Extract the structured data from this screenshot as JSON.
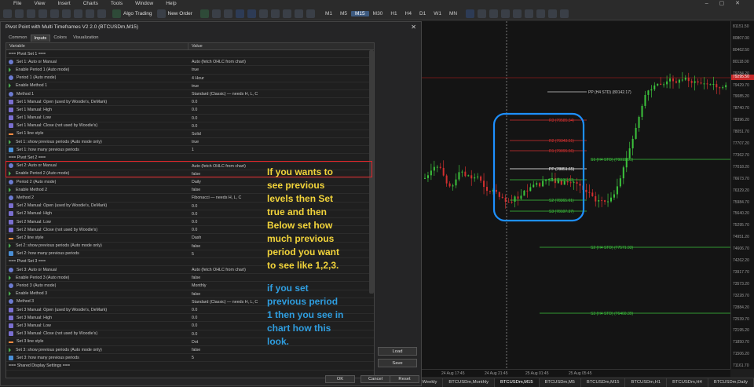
{
  "menu": [
    "File",
    "View",
    "Insert",
    "Charts",
    "Tools",
    "Window",
    "Help"
  ],
  "toolbar": {
    "algo_trading": "Algo Trading",
    "new_order": "New Order",
    "timeframes": [
      "M1",
      "M5",
      "M15",
      "M30",
      "H1",
      "H4",
      "D1",
      "W1",
      "MN"
    ],
    "active_timeframe": "M15"
  },
  "dialog": {
    "title": "Pivot Point with Multi Timeframes V2 2.0 (BTCUSDm,M15)",
    "tabs": [
      "Common",
      "Inputs",
      "Colors",
      "Visualization"
    ],
    "active_tab": "Inputs",
    "col_variable": "Variable",
    "col_value": "Value",
    "rows": [
      {
        "type": "section",
        "name": "=== Pivot Set 1 ===",
        "value": ""
      },
      {
        "icon": "circ",
        "name": "Set 1: Auto or Manual",
        "value": "Auto (fetch OHLC from chart)"
      },
      {
        "icon": "arrow",
        "name": "Enable Period 1 (Auto mode)",
        "value": "true"
      },
      {
        "icon": "circ",
        "name": "Period 1 (Auto mode)",
        "value": "4 Hour"
      },
      {
        "icon": "arrow",
        "name": "Enable Method 1",
        "value": "true"
      },
      {
        "icon": "circ",
        "name": "Method 1",
        "value": "Standard (Classic) — needs H, L, C"
      },
      {
        "icon": "num",
        "name": "Set 1 Manual: Open  (used by Woodie's, DeMark)",
        "value": "0.0"
      },
      {
        "icon": "num",
        "name": "Set 1 Manual: High",
        "value": "0.0"
      },
      {
        "icon": "num",
        "name": "Set 1 Manual: Low",
        "value": "0.0"
      },
      {
        "icon": "num",
        "name": "Set 1 Manual: Close (not used by Woodie's)",
        "value": "0.0"
      },
      {
        "icon": "line",
        "name": "Set 1 line style",
        "value": "Solid"
      },
      {
        "icon": "arrow",
        "name": "Set 1: show previous periods (Auto mode only)",
        "value": "true"
      },
      {
        "icon": "hash",
        "name": "Set 1: how many previous periods",
        "value": "1"
      },
      {
        "type": "section",
        "name": "=== Pivot Set 2 ===",
        "value": ""
      },
      {
        "icon": "circ",
        "name": "Set 2: Auto or Manual",
        "value": "Auto (fetch OHLC from chart)"
      },
      {
        "icon": "arrow",
        "name": "Enable Period 2 (Auto mode)",
        "value": "false"
      },
      {
        "icon": "circ",
        "name": "Period 2 (Auto mode)",
        "value": "Daily"
      },
      {
        "icon": "arrow",
        "name": "Enable Method 2",
        "value": "false"
      },
      {
        "icon": "circ",
        "name": "Method 2",
        "value": "Fibonacci — needs H, L, C"
      },
      {
        "icon": "num",
        "name": "Set 2 Manual: Open  (used by Woodie's, DeMark)",
        "value": "0.0"
      },
      {
        "icon": "num",
        "name": "Set 2 Manual: High",
        "value": "0.0"
      },
      {
        "icon": "num",
        "name": "Set 2 Manual: Low",
        "value": "0.0"
      },
      {
        "icon": "num",
        "name": "Set 2 Manual: Close (not used by Woodie's)",
        "value": "0.0"
      },
      {
        "icon": "line",
        "name": "Set 2 line style",
        "value": "Dash"
      },
      {
        "icon": "arrow",
        "name": "Set 2: show previous periods (Auto mode only)",
        "value": "false"
      },
      {
        "icon": "hash",
        "name": "Set 2: how many previous periods",
        "value": "5"
      },
      {
        "type": "section",
        "name": "=== Pivot Set 3 ===",
        "value": ""
      },
      {
        "icon": "circ",
        "name": "Set 3: Auto or Manual",
        "value": "Auto (fetch OHLC from chart)"
      },
      {
        "icon": "arrow",
        "name": "Enable Period 3 (Auto mode)",
        "value": "false"
      },
      {
        "icon": "circ",
        "name": "Period 3 (Auto mode)",
        "value": "Monthly"
      },
      {
        "icon": "arrow",
        "name": "Enable Method 3",
        "value": "false"
      },
      {
        "icon": "circ",
        "name": "Method 3",
        "value": "Standard (Classic) — needs H, L, C"
      },
      {
        "icon": "num",
        "name": "Set 3 Manual: Open  (used by Woodie's, DeMark)",
        "value": "0.0"
      },
      {
        "icon": "num",
        "name": "Set 3 Manual: High",
        "value": "0.0"
      },
      {
        "icon": "num",
        "name": "Set 3 Manual: Low",
        "value": "0.0"
      },
      {
        "icon": "num",
        "name": "Set 3 Manual: Close (not used by Woodie's)",
        "value": "0.0"
      },
      {
        "icon": "line",
        "name": "Set 3 line style",
        "value": "Dot"
      },
      {
        "icon": "arrow",
        "name": "Set 3: show previous periods (Auto mode only)",
        "value": "false"
      },
      {
        "icon": "hash",
        "name": "Set 3: how many previous periods",
        "value": "5"
      },
      {
        "type": "section",
        "name": "=== Shared Display Settings ===",
        "value": ""
      }
    ],
    "load_label": "Load",
    "save_label": "Save",
    "ok_label": "OK",
    "cancel_label": "Cancel",
    "reset_label": "Reset"
  },
  "annotations": {
    "yellow_lines": [
      "If you wants to",
      "see previous",
      "levels then Set",
      "true and then",
      "Below set how",
      "much previous",
      "period you want",
      "to see like 1,2,3."
    ],
    "blue_lines": [
      "if you set",
      "previous period",
      "1 then you see in",
      "chart how this",
      "look."
    ]
  },
  "chart": {
    "y_ticks": [
      "81151.50",
      "80807.00",
      "80462.50",
      "80118.00",
      "79784.20",
      "79429.70",
      "79085.20",
      "78740.70",
      "78396.20",
      "78051.70",
      "77707.20",
      "77362.70",
      "77018.20",
      "76673.70",
      "76329.20",
      "75984.70",
      "75640.20",
      "75295.70",
      "74951.20",
      "74606.70",
      "74262.20",
      "73917.70",
      "73573.20",
      "73228.70",
      "72884.20",
      "72539.70",
      "72195.20",
      "71850.70",
      "71506.20",
      "71161.70"
    ],
    "current_price": "79295.50",
    "x_ticks": [
      "24 Aug 17:45",
      "24 Aug 21:45",
      "25 Aug 01:45",
      "25 Aug 05:45"
    ],
    "levels": {
      "pp_current": "PP (H4 STD) (80142.17)",
      "r3": "R3 (79585.34)",
      "r2": "R2 (79343.51)",
      "r1": "R1 (79095.56)",
      "pp_prev": "PP (78851.65)",
      "s1": "S1 (78606.03)",
      "s2": "S2 (78365.01)",
      "s3": "S3 (78107.37)",
      "s1_h4": "S1 (H4 STD) (79019.51)",
      "s2_h4": "S2 (H4 STD) (77571.93)",
      "s3_h4": "S3 (H4 STD) (76460.39)"
    }
  },
  "bottom_tabs": [
    "BTCUSDm,Weekly",
    "BTCUSDm,Monthly",
    "BTCUSDm,M15",
    "BTCUSDm,M5",
    "BTCUSDm,M15",
    "BTCUSDm,H1",
    "BTCUSDm,H4",
    "BTCUSDm,Daily"
  ],
  "active_bottom_tab": 2
}
